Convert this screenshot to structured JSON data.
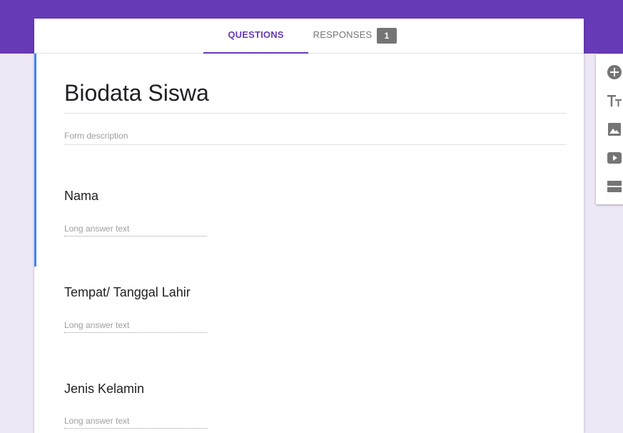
{
  "tabs": {
    "questions": "QUESTIONS",
    "responses": "RESPONSES",
    "responses_count": "1"
  },
  "form": {
    "title": "Biodata Siswa",
    "description_placeholder": "Form description",
    "questions": [
      {
        "title": "Nama",
        "answer_placeholder": "Long answer text"
      },
      {
        "title": "Tempat/ Tanggal Lahir",
        "answer_placeholder": "Long answer text"
      },
      {
        "title": "Jenis Kelamin",
        "answer_placeholder": "Long answer text"
      }
    ]
  },
  "toolbar": {
    "icons": [
      "add-question-icon",
      "add-title-icon",
      "add-image-icon",
      "add-video-icon",
      "add-section-icon"
    ]
  },
  "colors": {
    "brand": "#673ab7",
    "background": "#ede7f6",
    "active_accent": "#4285f4",
    "icon_gray": "#757575"
  }
}
